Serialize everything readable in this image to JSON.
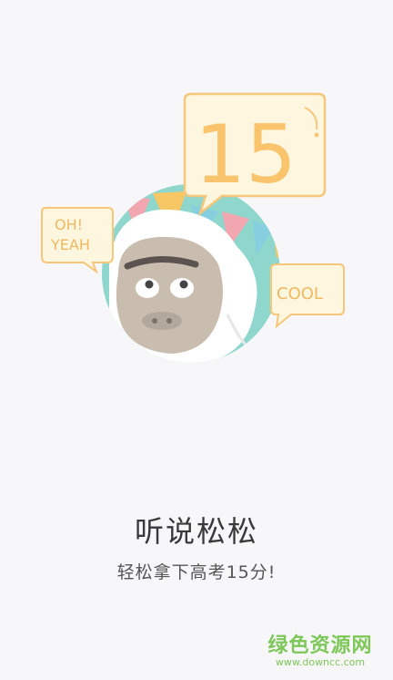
{
  "illustration": {
    "bubble_score": "15",
    "bubble_left_line1": "OH!",
    "bubble_left_line2": "YEAH",
    "bubble_right": "COOL",
    "colors": {
      "bubble_fill": "#fff6e0",
      "bubble_stroke": "#f6c77a",
      "score_text": "#f9c46b",
      "circle_bg": "#8fd6cc",
      "flag_pink": "#f2a7b0",
      "flag_yellow": "#f7c766",
      "flag_blue": "#86cfe0",
      "face": "#c9bdb0",
      "fur": "#ffffff"
    }
  },
  "title": "听说松松",
  "subtitle": "轻松拿下高考15分!",
  "watermark": {
    "main": "绿色资源网",
    "url": "www.downcc.com"
  }
}
